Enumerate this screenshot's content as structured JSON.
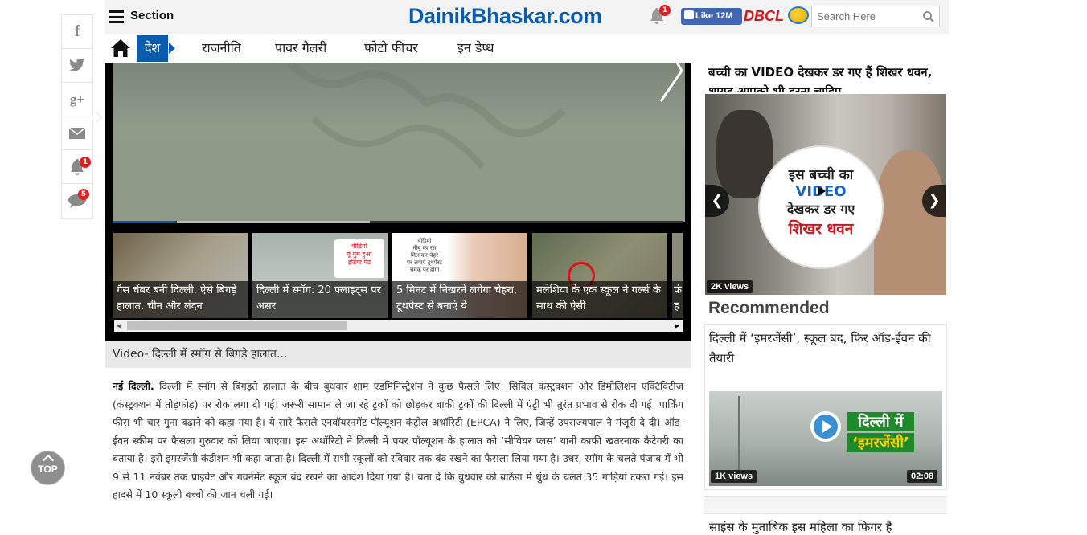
{
  "header": {
    "section_label": "Section",
    "logo_part1": "Dainik",
    "logo_part2": "Bhaskar.com",
    "notification_count": "1",
    "fb_like": "Like 12M",
    "dbcl": "DBCL",
    "search_placeholder": "Search Here"
  },
  "nav": {
    "active": "देश",
    "items": [
      "राजनीति",
      "पावर गैलरी",
      "फोटो फीचर",
      "इन डेप्थ"
    ]
  },
  "share": {
    "icons": [
      "facebook-icon",
      "twitter-icon",
      "google-plus-icon",
      "mail-icon",
      "bell-icon",
      "comment-icon"
    ],
    "bell_count": "1",
    "comment_count": "5"
  },
  "video": {
    "caption": "Video- दिल्ली में स्मॉग से बिगड़े हालात...",
    "progress": 0.11,
    "thumbs": [
      {
        "caption": "गैस चेंबर बनी दिल्ली, ऐसे बिगड़े हालात, चीन और लंदन"
      },
      {
        "caption": "दिल्ली में स्मॉग: 20 फ्लाइट्स पर असर",
        "overlay": "वीडियो\nयूं गुम हुआ\nइंडिया गेट"
      },
      {
        "caption": "5 मिनट में निखरने लगेगा चेहरा, टूथपेस्ट से बनाएं ये",
        "overlay": "वीडियो\nनींबू का रस\nमिलाकर चेहरे\nपर लगाएं टूथपेस्ट\nचमक पर होगा"
      },
      {
        "caption": "मलेशिया के एक स्कूल ने गर्ल्स के साथ की ऐसी"
      },
      {
        "caption": "फं ह"
      }
    ]
  },
  "article": {
    "dateline": "नई दिल्ली.",
    "body": "दिल्ली में स्मॉग से बिगड़ते हालात के बीच बुधवार शाम एडमिनिस्ट्रेशन ने कुछ फैसले लिए। सिविल कंस्ट्रक्शन और डिमोलिशन एक्टिविटीज (कंस्ट्रक्शन में तोड़फोड़) पर रोक लगा दी गई। जरूरी सामान ले जा रहे ट्रकों को छोड़कर बाकी ट्रकों की दिल्ली में एंट्री भी तुरंत प्रभाव से रोक दी गई। पार्किंग फीस भी चार गुना बढ़ाने को कहा गया है। ये सारे फैसले एनवॉयरनमेंट पॉल्यूशन कंट्रोल अथॉरिटी (EPCA) ने लिए, जिन्हें उपराज्यपाल ने मंजूरी दे दी। ऑड-ईवन स्कीम पर फैसला गुरुवार को लिया जाएगा। इस अथॉरिटी ने दिल्ली में पयर पॉल्यूशन के हालात को ‘सीवियर प्लस’ यानी काफी खतरनाक कैटेगरी का बताया है। इसे इमरजेंसी कंडीशन भी कहा जाता है। दिल्ली में सभी स्कूलों को रविवार तक बंद रखने का फैसला लिया गया है। उधर, स्मॉग के चलते पंजाब में भी 9 से 11 नवंबर तक प्राइवेट और गवर्नमेंट स्कूल बंद रखने का आदेश दिया गया है। बता दें कि बुधवार को बठिंडा में धुंध के चलते 35 गाड़ियां टकरा गईं। इस हादसे में 10 स्कूली बच्चों की जान चली गई।"
  },
  "top_button": "TOP",
  "right": {
    "story1_title": "बच्ची का VIDEO देखकर डर गए हैं शिखर धवन, शायद आपको भी डरना चाहिए",
    "story1_overlay_line1": "इस बच्ची का",
    "story1_overlay_line2": "VIDEO",
    "story1_overlay_line3": "देखकर डर गए",
    "story1_overlay_line4": "शिखर धवन",
    "story1_views": "2K views",
    "recommended_heading": "Recommended",
    "rec_title": "दिल्ली में ‘इमरजेंसी’, स्कूल बंद, फिर ऑड-ईवन की तैयारी",
    "rec_overlay_line1": "दिल्ली में",
    "rec_overlay_line2": "‘इमरजेंसी’",
    "rec_views": "1K views",
    "rec_duration": "02:08",
    "story3_title": "साइंस के मुताबिक इस महिला का फिगर है"
  },
  "colors": {
    "brand_blue": "#0b5cad",
    "brand_red": "#d8141b",
    "badge_red": "#e02020"
  }
}
